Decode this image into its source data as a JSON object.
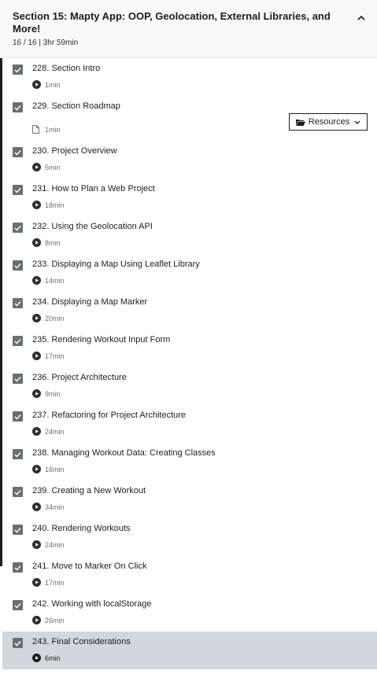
{
  "section": {
    "title": "Section 15: Mapty App: OOP, Geolocation, External Libraries, and More!",
    "meta": "16 / 16 | 3hr 59min"
  },
  "resources_label": "Resources",
  "lectures": [
    {
      "title": "228. Section Intro",
      "duration": "1min",
      "type": "video",
      "done": true
    },
    {
      "title": "229. Section Roadmap",
      "duration": "1min",
      "type": "article",
      "done": true
    },
    {
      "title": "230. Project Overview",
      "duration": "5min",
      "type": "video",
      "done": true
    },
    {
      "title": "231. How to Plan a Web Project",
      "duration": "18min",
      "type": "video",
      "done": true
    },
    {
      "title": "232. Using the Geolocation API",
      "duration": "8min",
      "type": "video",
      "done": true
    },
    {
      "title": "233. Displaying a Map Using Leaflet Library",
      "duration": "14min",
      "type": "video",
      "done": true
    },
    {
      "title": "234. Displaying a Map Marker",
      "duration": "20min",
      "type": "video",
      "done": true
    },
    {
      "title": "235. Rendering Workout Input Form",
      "duration": "17min",
      "type": "video",
      "done": true
    },
    {
      "title": "236. Project Architecture",
      "duration": "9min",
      "type": "video",
      "done": true
    },
    {
      "title": "237. Refactoring for Project Architecture",
      "duration": "24min",
      "type": "video",
      "done": true
    },
    {
      "title": "238. Managing Workout Data: Creating Classes",
      "duration": "16min",
      "type": "video",
      "done": true
    },
    {
      "title": "239. Creating a New Workout",
      "duration": "34min",
      "type": "video",
      "done": true
    },
    {
      "title": "240. Rendering Workouts",
      "duration": "24min",
      "type": "video",
      "done": true
    },
    {
      "title": "241. Move to Marker On Click",
      "duration": "17min",
      "type": "video",
      "done": true
    },
    {
      "title": "242. Working with localStorage",
      "duration": "26min",
      "type": "video",
      "done": true
    },
    {
      "title": "243. Final Considerations",
      "duration": "6min",
      "type": "video",
      "done": true,
      "active": true
    }
  ]
}
